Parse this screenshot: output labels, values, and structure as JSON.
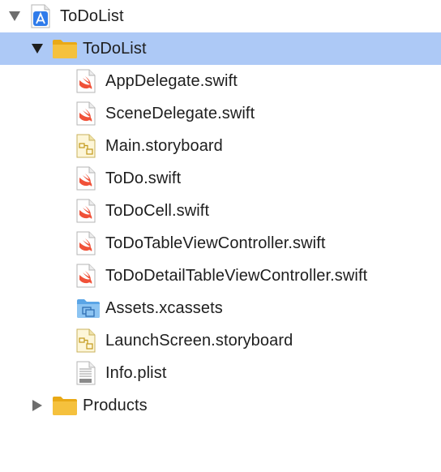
{
  "navigator": {
    "project": {
      "label": "ToDoList",
      "icon": "xcode-project-icon",
      "expanded": true
    },
    "group": {
      "label": "ToDoList",
      "icon": "folder-icon",
      "expanded": true,
      "selected": true
    },
    "files": [
      {
        "label": "AppDelegate.swift",
        "icon": "swift-file-icon"
      },
      {
        "label": "SceneDelegate.swift",
        "icon": "swift-file-icon"
      },
      {
        "label": "Main.storyboard",
        "icon": "storyboard-file-icon"
      },
      {
        "label": "ToDo.swift",
        "icon": "swift-file-icon"
      },
      {
        "label": "ToDoCell.swift",
        "icon": "swift-file-icon"
      },
      {
        "label": "ToDoTableViewController.swift",
        "icon": "swift-file-icon"
      },
      {
        "label": "ToDoDetailTableViewController.swift",
        "icon": "swift-file-icon"
      },
      {
        "label": "Assets.xcassets",
        "icon": "asset-catalog-icon"
      },
      {
        "label": "LaunchScreen.storyboard",
        "icon": "storyboard-file-icon"
      },
      {
        "label": "Info.plist",
        "icon": "plist-file-icon"
      }
    ],
    "products": {
      "label": "Products",
      "icon": "folder-icon",
      "expanded": false
    },
    "colors": {
      "selection": "#adc9f6",
      "folder": "#f5c13d",
      "swift": "#f05138",
      "project": "#2f7bea"
    }
  }
}
